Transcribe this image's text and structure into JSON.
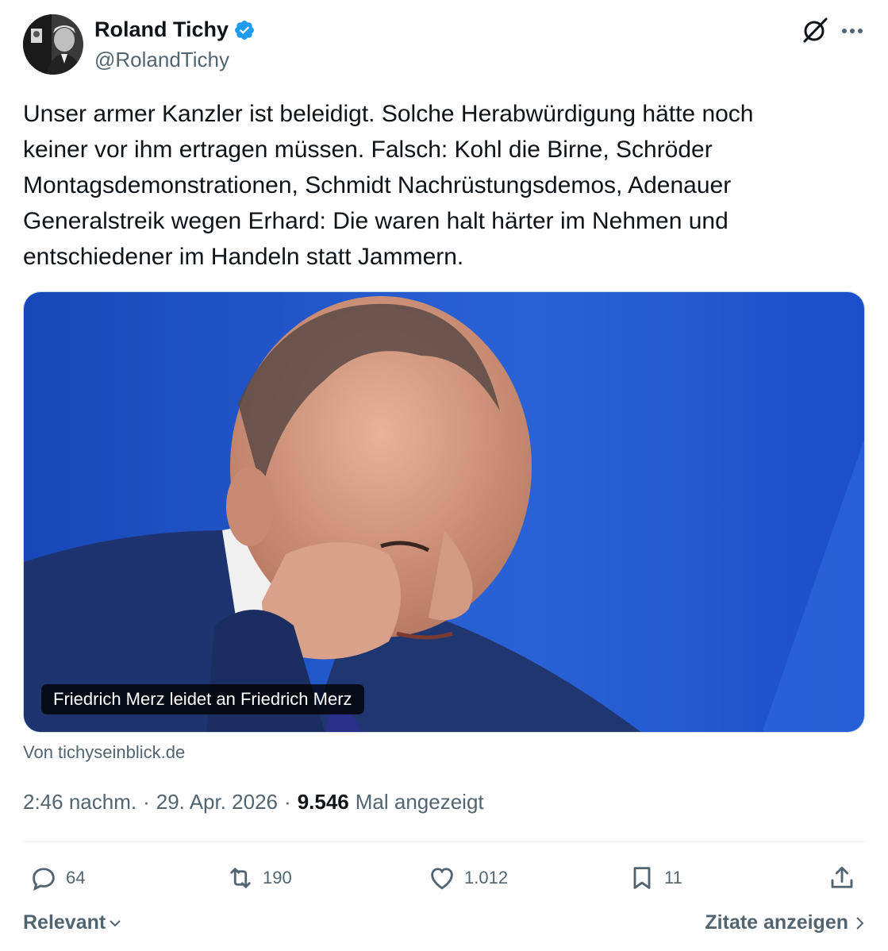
{
  "author": {
    "name": "Roland Tichy",
    "handle": "@RolandTichy",
    "verified": true
  },
  "tweet": {
    "text": "Unser armer Kanzler ist beleidigt. Solche Herabwürdigung hätte noch\nkeiner vor ihm ertragen müssen. Falsch: Kohl die Birne, Schröder\nMontagsdemonstrationen, Schmidt Nachrüstungsdemos, Adenauer\nGeneralstreik wegen Erhard: Die waren halt härter im Nehmen und\nentschiedener im Handeln statt Jammern."
  },
  "card": {
    "caption": "Friedrich Merz leidet an Friedrich Merz",
    "source": "Von tichyseinblick.de"
  },
  "meta": {
    "time": "2:46 nachm.",
    "separator": "·",
    "date": "29. Apr. 2026",
    "views": "9.546",
    "views_label": "Mal angezeigt"
  },
  "actions": {
    "replies": "64",
    "reposts": "190",
    "likes": "1.012",
    "bookmarks": "11"
  },
  "footer": {
    "sort_label": "Relevant",
    "quotes_label": "Zitate anzeigen"
  },
  "colors": {
    "verified": "#1d9bf0",
    "secondary_text": "#536471",
    "primary_text": "#0f1419",
    "image_background": "#1f4fc4"
  },
  "icons": [
    "verified-badge-icon",
    "grok-icon",
    "more-icon",
    "reply-icon",
    "repost-icon",
    "like-icon",
    "bookmark-icon",
    "share-icon",
    "chevron-down-icon",
    "chevron-right-icon"
  ]
}
